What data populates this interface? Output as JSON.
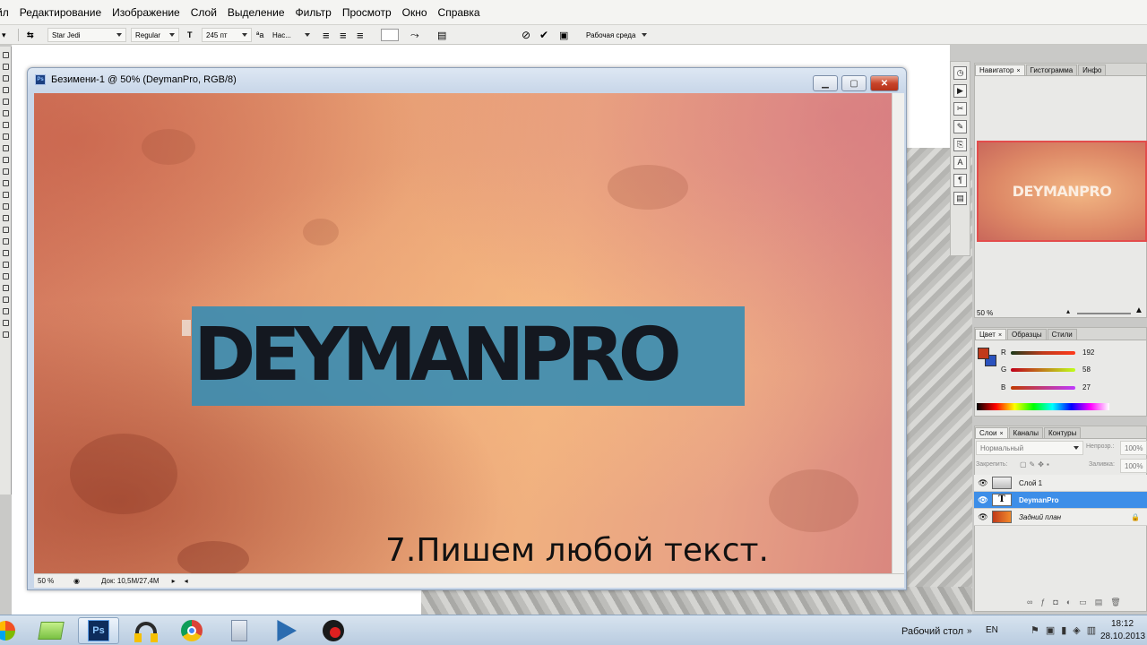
{
  "menu": [
    "йл",
    "Редактирование",
    "Изображение",
    "Слой",
    "Выделение",
    "Фильтр",
    "Просмотр",
    "Окно",
    "Справка"
  ],
  "options": {
    "font_family": "Star Jedi",
    "font_style": "Regular",
    "font_size": "245 пт",
    "antialias": "Нас...",
    "workspace": "Рабочая среда"
  },
  "document": {
    "title": "Безимени-1 @ 50% (DeymanPro, RGB/8)",
    "text": "DEYMANPRO",
    "caption": "7.Пишем любой текст.",
    "zoom": "50 %",
    "doc_info": "Док: 10,5M/27,4M"
  },
  "navigator": {
    "tabs": [
      "Навигатор",
      "Гистограмма",
      "Инфо"
    ],
    "thumb_text": "DEYMANPRO",
    "zoom": "50 %"
  },
  "color": {
    "tabs": [
      "Цвет",
      "Образцы",
      "Стили"
    ],
    "channels": [
      {
        "label": "R",
        "value": "192"
      },
      {
        "label": "G",
        "value": "58"
      },
      {
        "label": "B",
        "value": "27"
      }
    ],
    "fg": "#c03a1b",
    "bg": "#2a52be"
  },
  "layers": {
    "tabs": [
      "Слои",
      "Каналы",
      "Контуры"
    ],
    "blend": "Нормальный",
    "opacity_label": "Непрозр.:",
    "opacity": "100%",
    "lock_label": "Закрепить:",
    "fill_label": "Заливка:",
    "fill": "100%",
    "items": [
      {
        "name": "Слой 1",
        "selected": false
      },
      {
        "name": "DeymanPro",
        "selected": true
      },
      {
        "name": "Задний план",
        "selected": false
      }
    ]
  },
  "taskbar": {
    "desktop": "Рабочий стол",
    "lang": "EN",
    "time": "18:12",
    "date": "28.10.2013",
    "ps_label": "Ps"
  }
}
